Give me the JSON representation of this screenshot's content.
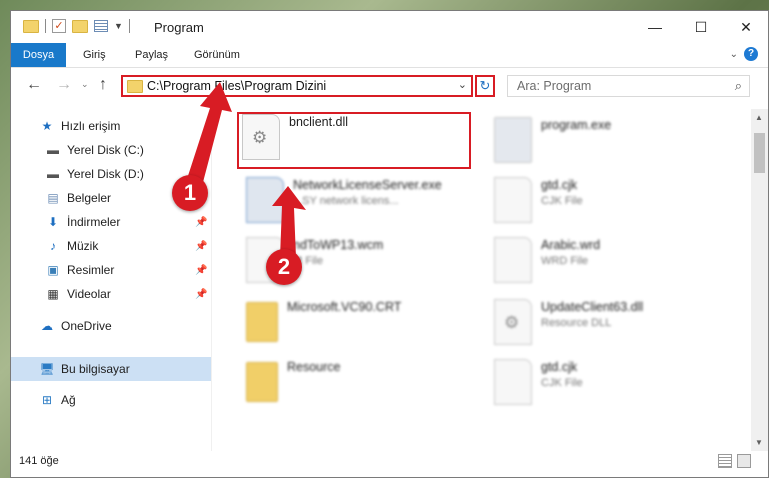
{
  "window": {
    "title": "Program",
    "controls": {
      "minimize": "—",
      "maximize": "☐",
      "close": "✕"
    }
  },
  "ribbon": {
    "tabs": [
      "Dosya",
      "Giriş",
      "Paylaş",
      "Görünüm"
    ],
    "help": "?"
  },
  "address": {
    "path": "C:\\Program Files\\Program Dizini",
    "search_placeholder": "Ara: Program"
  },
  "sidebar": {
    "items": [
      {
        "label": "Hızlı erişim",
        "icon": "star-icon"
      },
      {
        "label": "Yerel Disk (C:)",
        "icon": "drive-icon"
      },
      {
        "label": "Yerel Disk (D:)",
        "icon": "drive-icon"
      },
      {
        "label": "Belgeler",
        "icon": "documents-icon"
      },
      {
        "label": "İndirmeler",
        "icon": "download-icon"
      },
      {
        "label": "Müzik",
        "icon": "music-icon"
      },
      {
        "label": "Resimler",
        "icon": "pictures-icon"
      },
      {
        "label": "Videolar",
        "icon": "video-icon"
      },
      {
        "label": "OneDrive",
        "icon": "cloud-icon"
      },
      {
        "label": "Bu bilgisayar",
        "icon": "computer-icon"
      },
      {
        "label": "Ağ",
        "icon": "network-icon"
      }
    ]
  },
  "files": [
    {
      "name": "bnclient.dll",
      "sub": ""
    },
    {
      "name": "program.exe",
      "sub": ""
    },
    {
      "name": "NetworkLicenseServer.exe",
      "sub": "...SY network licens..."
    },
    {
      "name": "gtd.cjk",
      "sub": "CJK File"
    },
    {
      "name": "ndToWP13.wcm",
      "sub": "M File"
    },
    {
      "name": "Arabic.wrd",
      "sub": "WRD File"
    },
    {
      "name": "Microsoft.VC90.CRT",
      "sub": ""
    },
    {
      "name": "UpdateClient63.dll",
      "sub": "Resource DLL"
    },
    {
      "name": "Resource",
      "sub": ""
    },
    {
      "name": "gtd.cjk",
      "sub": "CJK File"
    }
  ],
  "status": {
    "count": "141 öğe"
  },
  "badges": [
    "1",
    "2"
  ],
  "colors": {
    "accent": "#1979ca",
    "highlight": "#d81c24"
  }
}
